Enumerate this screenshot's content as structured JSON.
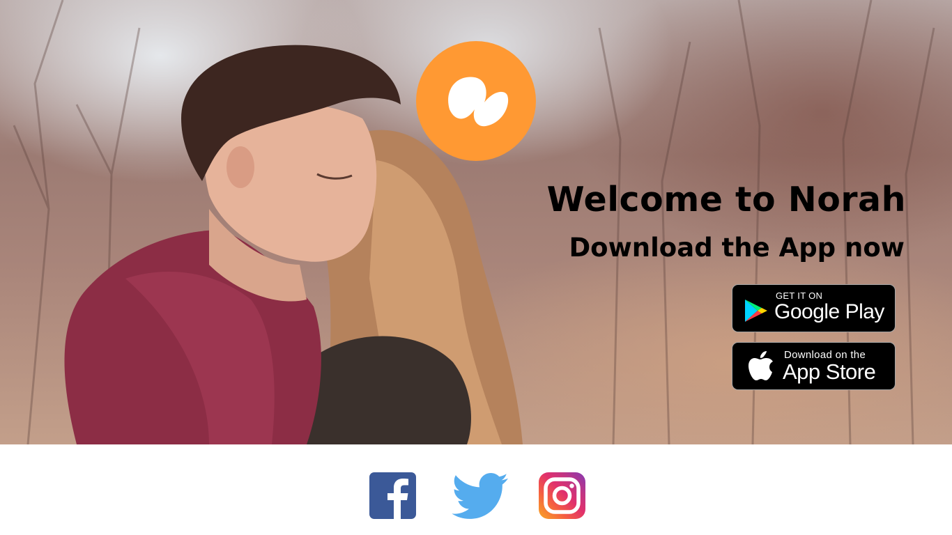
{
  "hero": {
    "background_image": "couple-embracing-outdoors-photo",
    "title": "Welcome to Norah",
    "subtitle": "Download the App now"
  },
  "logo": {
    "icon": "norah-logo-icon",
    "color": "#ff9933"
  },
  "store_buttons": {
    "google_play": {
      "small_text": "GET IT ON",
      "big_text": "Google Play",
      "icon": "google-play-icon"
    },
    "app_store": {
      "small_text": "Download on the",
      "big_text": "App Store",
      "icon": "apple-icon"
    }
  },
  "social": [
    {
      "name": "facebook",
      "icon": "facebook-icon",
      "color": "#3b5998"
    },
    {
      "name": "twitter",
      "icon": "twitter-icon",
      "color": "#55acee"
    },
    {
      "name": "instagram",
      "icon": "instagram-icon",
      "color": "#e1306c"
    }
  ]
}
